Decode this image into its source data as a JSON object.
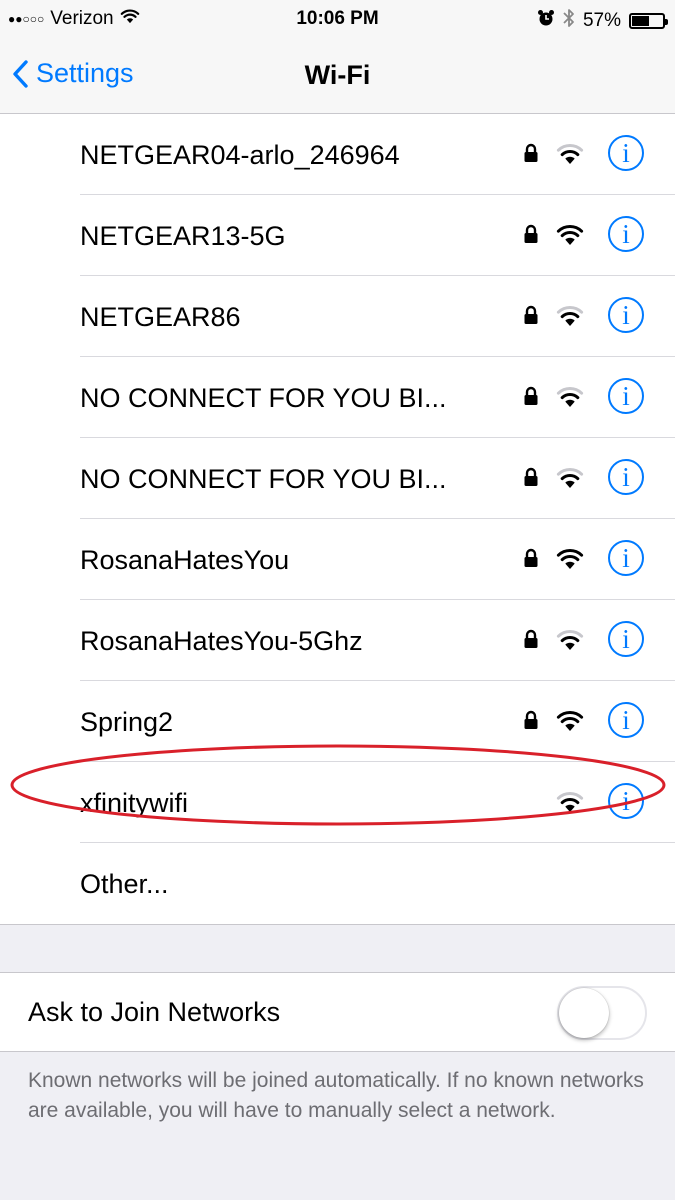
{
  "status_bar": {
    "signal_dots": "●●○○○",
    "carrier": "Verizon",
    "time": "10:06 PM",
    "alarm_icon": "alarm-icon",
    "bluetooth_icon": "bluetooth-icon",
    "battery_percent": "57%",
    "battery_level": 0.57
  },
  "nav": {
    "back_label": "Settings",
    "title": "Wi-Fi"
  },
  "networks": [
    {
      "name": "NETGEAR04-arlo_246964",
      "secured": true,
      "signal": 2
    },
    {
      "name": "NETGEAR13-5G",
      "secured": true,
      "signal": 3
    },
    {
      "name": "NETGEAR86",
      "secured": true,
      "signal": 2
    },
    {
      "name": "NO CONNECT FOR YOU BI...",
      "secured": true,
      "signal": 2
    },
    {
      "name": "NO CONNECT FOR YOU BI...",
      "secured": true,
      "signal": 2
    },
    {
      "name": "RosanaHatesYou",
      "secured": true,
      "signal": 3
    },
    {
      "name": "RosanaHatesYou-5Ghz",
      "secured": true,
      "signal": 2
    },
    {
      "name": "Spring2",
      "secured": true,
      "signal": 3
    },
    {
      "name": "xfinitywifi",
      "secured": false,
      "signal": 2
    }
  ],
  "other_label": "Other...",
  "ask_to_join": {
    "label": "Ask to Join Networks",
    "enabled": false
  },
  "footnote": "Known networks will be joined automatically. If no known networks are available, you will have to manually select a network.",
  "colors": {
    "accent": "#007aff",
    "annotation": "#d9202a",
    "background": "#efeff4"
  }
}
